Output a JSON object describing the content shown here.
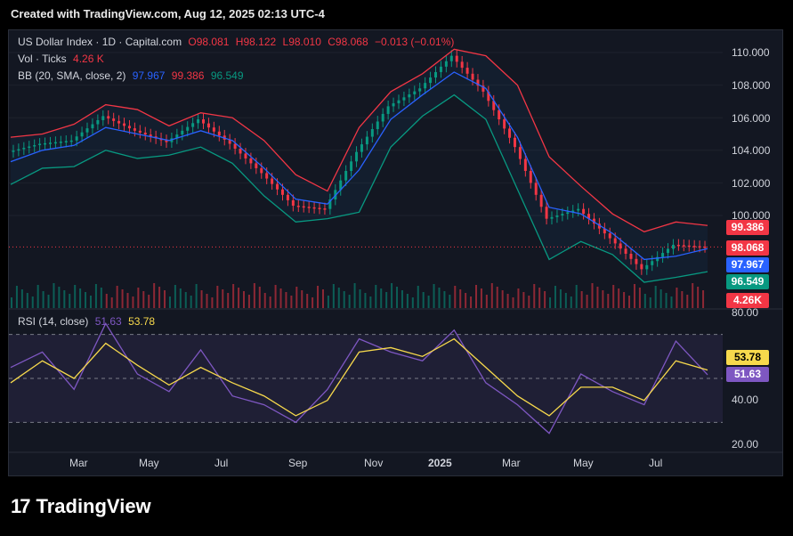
{
  "header": {
    "created_text": "Created with TradingView.com, Aug 12, 2025 02:13 UTC-4"
  },
  "legend": {
    "symbol": "US Dollar Index · 1D · Capital.com",
    "open": "O98.081",
    "high": "H98.122",
    "low": "L98.010",
    "close": "C98.068",
    "change": "−0.013 (−0.01%)",
    "vol_label": "Vol · Ticks",
    "vol_value": "4.26 K",
    "bb_label": "BB (20, SMA, close, 2)",
    "bb_mid": "97.967",
    "bb_upper": "99.386",
    "bb_lower": "96.549",
    "rsi_label": "RSI (14, close)",
    "rsi_value": "51.63",
    "rsi_ma": "53.78"
  },
  "tags": {
    "bb_upper": "99.386",
    "price": "98.068",
    "bb_mid": "97.967",
    "bb_lower": "96.549",
    "volume": "4.26K",
    "rsi_ma": "53.78",
    "rsi": "51.63"
  },
  "brand": {
    "name": "TradingView"
  },
  "colors": {
    "up": "#089981",
    "down": "#f23645",
    "bb_mid": "#2962ff",
    "bb_upper": "#f23645",
    "bb_lower": "#089981",
    "rsi": "#7e57c2",
    "rsi_ma": "#f7d94c"
  },
  "chart_data": [
    {
      "type": "line",
      "title": "US Dollar Index · 1D · Capital.com",
      "x_ticks": [
        "Mar",
        "May",
        "Jul",
        "Sep",
        "Nov",
        "2025",
        "Mar",
        "May",
        "Jul"
      ],
      "y_ticks": [
        "110.000",
        "108.000",
        "106.000",
        "104.000",
        "102.000",
        "100.000"
      ],
      "ylim": [
        96,
        111
      ],
      "x": [
        "2024-02",
        "2024-03",
        "2024-04",
        "2024-04-20",
        "2024-05",
        "2024-06",
        "2024-06-25",
        "2024-07",
        "2024-08",
        "2024-09",
        "2024-09-27",
        "2024-10",
        "2024-11",
        "2024-12",
        "2025-01-13",
        "2025-02",
        "2025-03",
        "2025-04",
        "2025-05",
        "2025-06",
        "2025-07-01",
        "2025-07",
        "2025-08"
      ],
      "series": [
        {
          "name": "Close",
          "values": [
            103.9,
            104.4,
            104.6,
            106.1,
            105.2,
            104.5,
            105.9,
            104.4,
            102.6,
            100.6,
            100.4,
            103.9,
            106.7,
            107.8,
            109.8,
            107.6,
            104.2,
            99.8,
            100.4,
            98.6,
            96.7,
            98.2,
            98.068
          ]
        },
        {
          "name": "BB Basis",
          "values": [
            103.3,
            104.0,
            104.3,
            105.4,
            105.0,
            104.6,
            105.2,
            104.6,
            102.9,
            101.0,
            100.7,
            102.8,
            105.9,
            107.4,
            108.8,
            107.8,
            104.8,
            100.5,
            100.1,
            98.9,
            97.3,
            97.5,
            97.967
          ]
        },
        {
          "name": "BB Upper",
          "values": [
            104.8,
            105.0,
            105.6,
            106.8,
            106.5,
            105.5,
            106.3,
            106.0,
            104.6,
            102.5,
            101.5,
            105.4,
            107.6,
            108.7,
            110.2,
            109.8,
            108.0,
            103.6,
            101.8,
            100.1,
            99.0,
            99.6,
            99.386
          ]
        },
        {
          "name": "BB Lower",
          "values": [
            101.9,
            102.9,
            103.0,
            104.0,
            103.5,
            103.7,
            104.2,
            103.2,
            101.2,
            99.6,
            99.8,
            100.2,
            104.2,
            106.1,
            107.4,
            105.9,
            101.6,
            97.3,
            98.4,
            97.6,
            95.9,
            96.2,
            96.549
          ]
        }
      ],
      "volume_last": "4.26K"
    },
    {
      "type": "line",
      "title": "RSI (14, close)",
      "y_ticks": [
        "80.00",
        "40.00",
        "20.00"
      ],
      "ylim": [
        20,
        80
      ],
      "x": [
        "2024-02",
        "2024-03",
        "2024-04",
        "2024-04-20",
        "2024-05",
        "2024-06",
        "2024-06-25",
        "2024-07",
        "2024-08",
        "2024-09",
        "2024-09-27",
        "2024-10",
        "2024-11",
        "2024-12",
        "2025-01-13",
        "2025-02",
        "2025-03",
        "2025-04",
        "2025-05",
        "2025-06",
        "2025-07-01",
        "2025-07",
        "2025-08"
      ],
      "series": [
        {
          "name": "RSI",
          "values": [
            55,
            62,
            45,
            75,
            52,
            44,
            63,
            42,
            38,
            30,
            45,
            68,
            62,
            58,
            72,
            48,
            38,
            25,
            52,
            44,
            38,
            67,
            51.63
          ]
        },
        {
          "name": "RSI MA",
          "values": [
            48,
            58,
            50,
            66,
            56,
            47,
            55,
            48,
            42,
            33,
            40,
            62,
            64,
            60,
            68,
            55,
            42,
            33,
            46,
            46,
            40,
            58,
            53.78
          ]
        }
      ],
      "levels": [
        70,
        50,
        30
      ]
    }
  ]
}
